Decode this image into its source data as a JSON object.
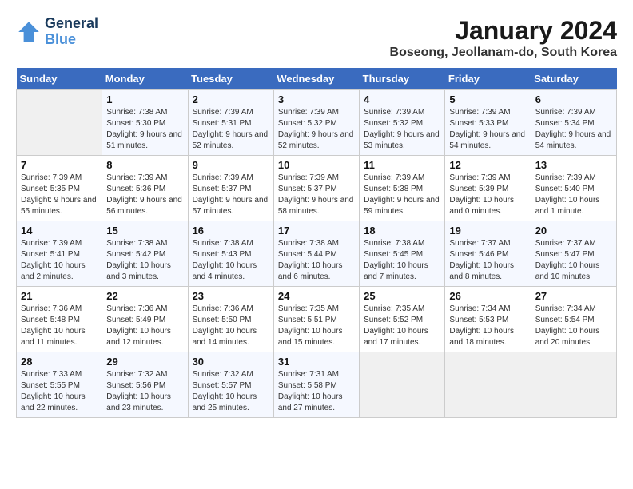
{
  "header": {
    "logo_line1": "General",
    "logo_line2": "Blue",
    "title": "January 2024",
    "subtitle": "Boseong, Jeollanam-do, South Korea"
  },
  "weekdays": [
    "Sunday",
    "Monday",
    "Tuesday",
    "Wednesday",
    "Thursday",
    "Friday",
    "Saturday"
  ],
  "weeks": [
    [
      {
        "day": "",
        "sunrise": "",
        "sunset": "",
        "daylight": ""
      },
      {
        "day": "1",
        "sunrise": "Sunrise: 7:38 AM",
        "sunset": "Sunset: 5:30 PM",
        "daylight": "Daylight: 9 hours and 51 minutes."
      },
      {
        "day": "2",
        "sunrise": "Sunrise: 7:39 AM",
        "sunset": "Sunset: 5:31 PM",
        "daylight": "Daylight: 9 hours and 52 minutes."
      },
      {
        "day": "3",
        "sunrise": "Sunrise: 7:39 AM",
        "sunset": "Sunset: 5:32 PM",
        "daylight": "Daylight: 9 hours and 52 minutes."
      },
      {
        "day": "4",
        "sunrise": "Sunrise: 7:39 AM",
        "sunset": "Sunset: 5:32 PM",
        "daylight": "Daylight: 9 hours and 53 minutes."
      },
      {
        "day": "5",
        "sunrise": "Sunrise: 7:39 AM",
        "sunset": "Sunset: 5:33 PM",
        "daylight": "Daylight: 9 hours and 54 minutes."
      },
      {
        "day": "6",
        "sunrise": "Sunrise: 7:39 AM",
        "sunset": "Sunset: 5:34 PM",
        "daylight": "Daylight: 9 hours and 54 minutes."
      }
    ],
    [
      {
        "day": "7",
        "sunrise": "Sunrise: 7:39 AM",
        "sunset": "Sunset: 5:35 PM",
        "daylight": "Daylight: 9 hours and 55 minutes."
      },
      {
        "day": "8",
        "sunrise": "Sunrise: 7:39 AM",
        "sunset": "Sunset: 5:36 PM",
        "daylight": "Daylight: 9 hours and 56 minutes."
      },
      {
        "day": "9",
        "sunrise": "Sunrise: 7:39 AM",
        "sunset": "Sunset: 5:37 PM",
        "daylight": "Daylight: 9 hours and 57 minutes."
      },
      {
        "day": "10",
        "sunrise": "Sunrise: 7:39 AM",
        "sunset": "Sunset: 5:37 PM",
        "daylight": "Daylight: 9 hours and 58 minutes."
      },
      {
        "day": "11",
        "sunrise": "Sunrise: 7:39 AM",
        "sunset": "Sunset: 5:38 PM",
        "daylight": "Daylight: 9 hours and 59 minutes."
      },
      {
        "day": "12",
        "sunrise": "Sunrise: 7:39 AM",
        "sunset": "Sunset: 5:39 PM",
        "daylight": "Daylight: 10 hours and 0 minutes."
      },
      {
        "day": "13",
        "sunrise": "Sunrise: 7:39 AM",
        "sunset": "Sunset: 5:40 PM",
        "daylight": "Daylight: 10 hours and 1 minute."
      }
    ],
    [
      {
        "day": "14",
        "sunrise": "Sunrise: 7:39 AM",
        "sunset": "Sunset: 5:41 PM",
        "daylight": "Daylight: 10 hours and 2 minutes."
      },
      {
        "day": "15",
        "sunrise": "Sunrise: 7:38 AM",
        "sunset": "Sunset: 5:42 PM",
        "daylight": "Daylight: 10 hours and 3 minutes."
      },
      {
        "day": "16",
        "sunrise": "Sunrise: 7:38 AM",
        "sunset": "Sunset: 5:43 PM",
        "daylight": "Daylight: 10 hours and 4 minutes."
      },
      {
        "day": "17",
        "sunrise": "Sunrise: 7:38 AM",
        "sunset": "Sunset: 5:44 PM",
        "daylight": "Daylight: 10 hours and 6 minutes."
      },
      {
        "day": "18",
        "sunrise": "Sunrise: 7:38 AM",
        "sunset": "Sunset: 5:45 PM",
        "daylight": "Daylight: 10 hours and 7 minutes."
      },
      {
        "day": "19",
        "sunrise": "Sunrise: 7:37 AM",
        "sunset": "Sunset: 5:46 PM",
        "daylight": "Daylight: 10 hours and 8 minutes."
      },
      {
        "day": "20",
        "sunrise": "Sunrise: 7:37 AM",
        "sunset": "Sunset: 5:47 PM",
        "daylight": "Daylight: 10 hours and 10 minutes."
      }
    ],
    [
      {
        "day": "21",
        "sunrise": "Sunrise: 7:36 AM",
        "sunset": "Sunset: 5:48 PM",
        "daylight": "Daylight: 10 hours and 11 minutes."
      },
      {
        "day": "22",
        "sunrise": "Sunrise: 7:36 AM",
        "sunset": "Sunset: 5:49 PM",
        "daylight": "Daylight: 10 hours and 12 minutes."
      },
      {
        "day": "23",
        "sunrise": "Sunrise: 7:36 AM",
        "sunset": "Sunset: 5:50 PM",
        "daylight": "Daylight: 10 hours and 14 minutes."
      },
      {
        "day": "24",
        "sunrise": "Sunrise: 7:35 AM",
        "sunset": "Sunset: 5:51 PM",
        "daylight": "Daylight: 10 hours and 15 minutes."
      },
      {
        "day": "25",
        "sunrise": "Sunrise: 7:35 AM",
        "sunset": "Sunset: 5:52 PM",
        "daylight": "Daylight: 10 hours and 17 minutes."
      },
      {
        "day": "26",
        "sunrise": "Sunrise: 7:34 AM",
        "sunset": "Sunset: 5:53 PM",
        "daylight": "Daylight: 10 hours and 18 minutes."
      },
      {
        "day": "27",
        "sunrise": "Sunrise: 7:34 AM",
        "sunset": "Sunset: 5:54 PM",
        "daylight": "Daylight: 10 hours and 20 minutes."
      }
    ],
    [
      {
        "day": "28",
        "sunrise": "Sunrise: 7:33 AM",
        "sunset": "Sunset: 5:55 PM",
        "daylight": "Daylight: 10 hours and 22 minutes."
      },
      {
        "day": "29",
        "sunrise": "Sunrise: 7:32 AM",
        "sunset": "Sunset: 5:56 PM",
        "daylight": "Daylight: 10 hours and 23 minutes."
      },
      {
        "day": "30",
        "sunrise": "Sunrise: 7:32 AM",
        "sunset": "Sunset: 5:57 PM",
        "daylight": "Daylight: 10 hours and 25 minutes."
      },
      {
        "day": "31",
        "sunrise": "Sunrise: 7:31 AM",
        "sunset": "Sunset: 5:58 PM",
        "daylight": "Daylight: 10 hours and 27 minutes."
      },
      {
        "day": "",
        "sunrise": "",
        "sunset": "",
        "daylight": ""
      },
      {
        "day": "",
        "sunrise": "",
        "sunset": "",
        "daylight": ""
      },
      {
        "day": "",
        "sunrise": "",
        "sunset": "",
        "daylight": ""
      }
    ]
  ]
}
